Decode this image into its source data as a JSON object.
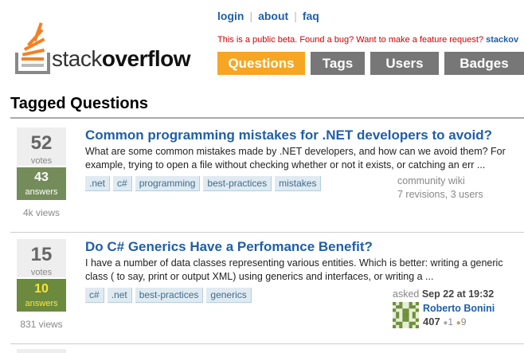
{
  "header": {
    "links": [
      "login",
      "about",
      "faq"
    ],
    "logo": {
      "text_light": "stack",
      "text_bold": "overflow"
    },
    "beta_notice": "This is a public beta. Found a bug? Want to make a feature request?",
    "beta_link": "stackov",
    "tabs": [
      "Questions",
      "Tags",
      "Users",
      "Badges",
      ""
    ]
  },
  "page_title": "Tagged Questions",
  "questions": [
    {
      "votes": "52",
      "votes_label": "votes",
      "answers": "43",
      "answers_label": "answers",
      "views": "4k views",
      "title": "Common programming mistakes for .NET developers to avoid?",
      "excerpt": "What are some common mistakes made by .NET developers, and how can we avoid them? For example, trying to open a file without checking whether or not it exists, or catching an err ...",
      "tags": [
        ".net",
        "c#",
        "programming",
        "best-practices",
        "mistakes"
      ],
      "wiki_line1": "community wiki",
      "wiki_line2": "7 revisions, 3 users"
    },
    {
      "votes": "15",
      "votes_label": "votes",
      "answers": "10",
      "answers_label": "answers",
      "views": "831 views",
      "title": "Do C# Generics Have a Perfomance Benefit?",
      "excerpt": "I have a number of data classes representing various entities. Which is better: writing a generic class ( to say, print or output XML) using generics and interfaces, or writing a ...",
      "tags": [
        "c#",
        ".net",
        "best-practices",
        "generics"
      ],
      "asked_prefix": "asked",
      "asked_date": "Sep 22 at 19:32",
      "user": {
        "name": "Roberto Bonini",
        "rep": "407",
        "silver": "1",
        "bronze": "9"
      }
    }
  ],
  "colors": {
    "accent": "#f6a623",
    "link": "#1f5fa8",
    "accepted": "#748c5a"
  }
}
